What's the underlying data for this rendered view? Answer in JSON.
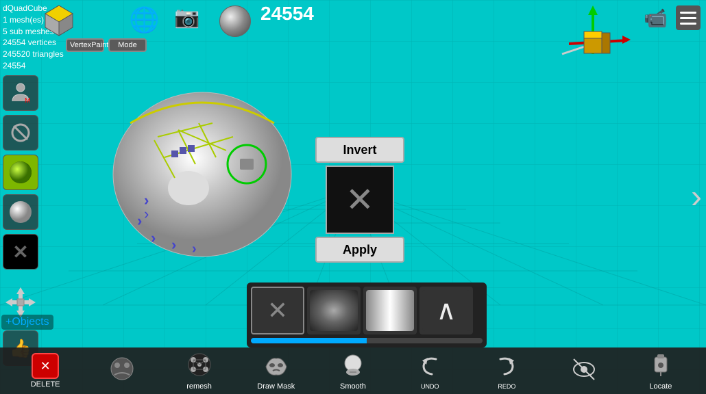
{
  "viewport": {
    "background_color": "#00c0c0"
  },
  "top_left": {
    "object_name": "dQuadCube",
    "mesh_count": "1 mesh(es)",
    "sub_meshes": "5 sub meshes",
    "vertices": "24554 vertices",
    "triangles": "245520 triangles",
    "counter": "24554"
  },
  "top_counter": "24554",
  "toolbar_top": {
    "vertex_paint": "VertexPaint",
    "mode": "Mode"
  },
  "invert_popup": {
    "invert_label": "Invert",
    "apply_label": "Apply"
  },
  "left_tools": [
    {
      "name": "object-tool",
      "icon": "👤"
    },
    {
      "name": "no-symbol",
      "icon": "⊘"
    },
    {
      "name": "green-sphere",
      "icon": "●"
    },
    {
      "name": "white-circle",
      "icon": "○"
    },
    {
      "name": "x-tool",
      "icon": "✕"
    }
  ],
  "bottom_toolbar": {
    "tools": [
      {
        "name": "delete",
        "label": "DELETE",
        "icon": "✕"
      },
      {
        "name": "ghost",
        "label": "",
        "icon": "👻"
      },
      {
        "name": "remesh",
        "label": "remesh",
        "icon": "⚙"
      },
      {
        "name": "draw-mask",
        "label": "Draw Mask",
        "icon": "🎭"
      },
      {
        "name": "smooth",
        "label": "Smooth",
        "icon": "✋"
      },
      {
        "name": "undo",
        "label": "UNDO",
        "icon": "↩"
      },
      {
        "name": "redo",
        "label": "REDO",
        "icon": "↪"
      },
      {
        "name": "hide",
        "label": "",
        "icon": "👁"
      },
      {
        "name": "locate",
        "label": "Locate",
        "icon": "📍"
      }
    ]
  },
  "brush_panel": {
    "brushes": [
      {
        "name": "x-brush",
        "type": "x"
      },
      {
        "name": "noise-brush",
        "type": "noise"
      },
      {
        "name": "gradient-brush",
        "type": "gradient"
      },
      {
        "name": "chevron-brush",
        "type": "chevron"
      }
    ],
    "progress": 50
  }
}
